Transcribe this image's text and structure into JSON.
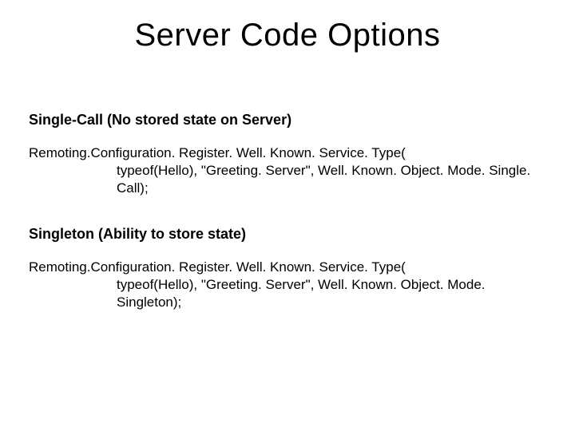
{
  "title": "Server Code Options",
  "sections": [
    {
      "heading": "Single-Call (No stored state on Server)",
      "code_line1": "Remoting.Configuration. Register. Well. Known. Service. Type(",
      "code_line2": "typeof(Hello), \"Greeting. Server\", Well. Known. Object. Mode. Single. Call);"
    },
    {
      "heading": "Singleton (Ability to store state)",
      "code_line1": "Remoting.Configuration. Register. Well. Known. Service. Type(",
      "code_line2": "typeof(Hello), \"Greeting. Server\", Well. Known. Object. Mode. Singleton);"
    }
  ]
}
